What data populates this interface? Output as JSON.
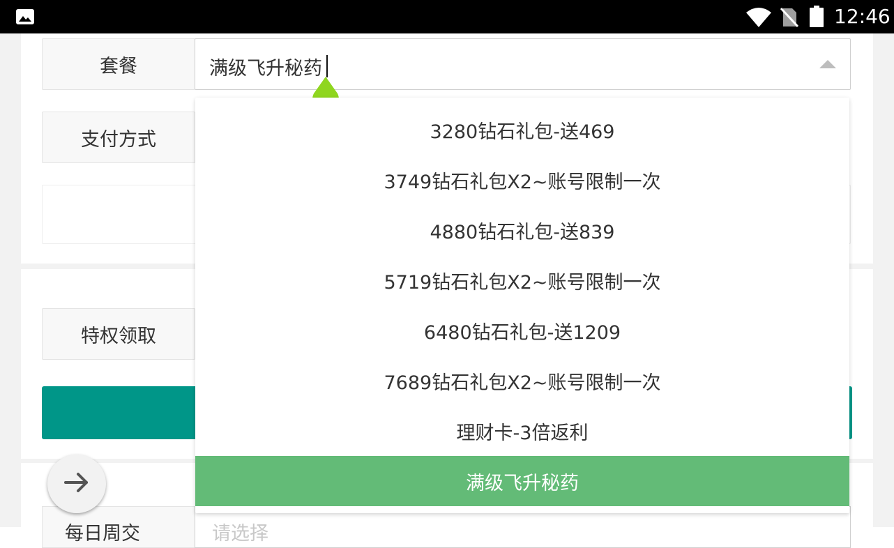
{
  "status_bar": {
    "time": "12:46",
    "icons": [
      "image-icon",
      "wifi-icon",
      "no-sim-icon",
      "battery-icon"
    ]
  },
  "form": {
    "package_label": "套餐",
    "package_value": "满级飞升秘药",
    "payment_label": "支付方式",
    "privilege_label": "特权领取",
    "weekly_label": "每日周交",
    "weekly_placeholder": "请选择"
  },
  "dropdown": {
    "options": [
      "3280钻石礼包-送469",
      "3749钻石礼包X2~账号限制一次",
      "4880钻石礼包-送839",
      "5719钻石礼包X2~账号限制一次",
      "6480钻石礼包-送1209",
      "7689钻石礼包X2~账号限制一次",
      "理财卡-3倍返利",
      "满级飞升秘药"
    ],
    "selected_index": 7
  },
  "colors": {
    "primary": "#009688",
    "selected_option": "#63bb77",
    "text_handle": "#8fd61f"
  }
}
